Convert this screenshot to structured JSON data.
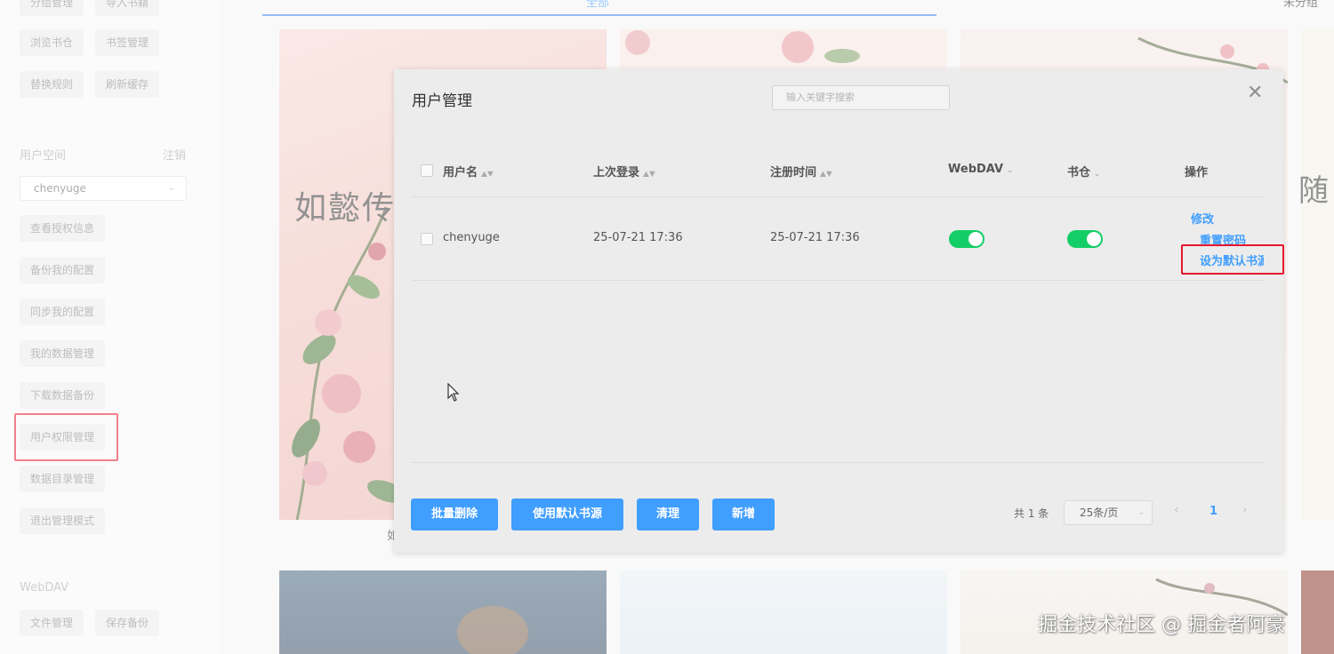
{
  "sidebar": {
    "top_buttons": [
      "分组管理",
      "导入书籍",
      "浏览书仓",
      "书签管理",
      "替换规则",
      "刷新缓存"
    ],
    "user_section": {
      "title": "用户空间",
      "logout": "注销",
      "current_user": "chenyuge",
      "items": [
        "查看授权信息",
        "备份我的配置",
        "同步我的配置",
        "我的数据管理",
        "下载数据备份",
        "用户权限管理",
        "数据目录管理",
        "退出管理模式"
      ]
    },
    "webdav_section": {
      "title": "WebDAV",
      "items": [
        "文件管理",
        "保存备份"
      ]
    }
  },
  "main": {
    "tab_all": "全部",
    "tab_ungrouped": "未分组",
    "book_cover_title": "如懿传",
    "book_cover_title2": "随",
    "book_caption": "如",
    "highlight_color": "#e6162d",
    "accent_color": "#409eff"
  },
  "dialog": {
    "title": "用户管理",
    "search_placeholder": "输入关键字搜索",
    "close_icon": "close-icon",
    "columns": {
      "username": "用户名",
      "last_login": "上次登录",
      "register_time": "注册时间",
      "webdav": "WebDAV",
      "bookstore": "书仓",
      "actions": "操作"
    },
    "rows": [
      {
        "username": "chenyuge",
        "last_login": "25-07-21 17:36",
        "register_time": "25-07-21 17:36",
        "webdav_enabled": true,
        "bookstore_enabled": true,
        "actions": [
          "修改",
          "重置密码",
          "设为默认书源"
        ]
      }
    ],
    "buttons": {
      "batch_delete": "批量删除",
      "use_default_source": "使用默认书源",
      "clear": "清理",
      "add": "新增"
    },
    "pagination": {
      "total": "共 1 条",
      "page_size": "25条/页",
      "current_page": "1"
    }
  },
  "watermark": "掘金技术社区 @ 掘金者阿豪"
}
